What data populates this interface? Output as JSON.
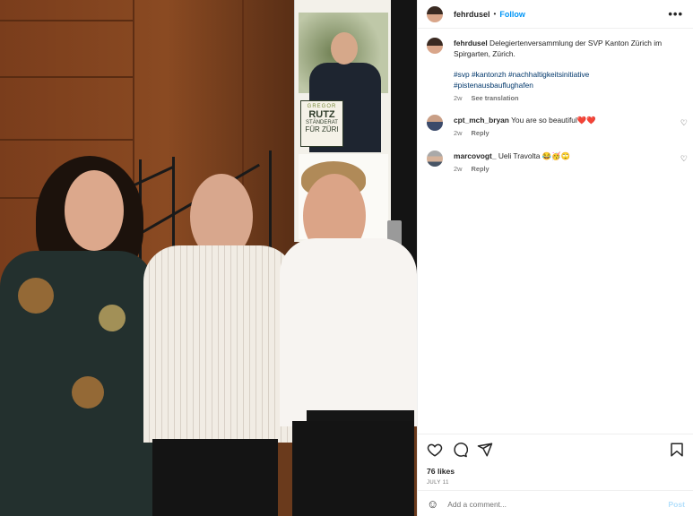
{
  "post": {
    "username": "fehrdusel",
    "follow_label": "Follow",
    "separator": "•",
    "more_label": "•••",
    "caption": "Delegiertenversammlung der SVP Kanton Zürich im Spirgarten, Zürich.",
    "hashtags_line1": "#svp #kantonzh #nachhaltigkeitsinitiative",
    "hashtags_line2": "#pistenausbauflughafen",
    "age": "2w",
    "see_translation": "See translation"
  },
  "banner": {
    "line1": "GREGOR",
    "line2": "RUTZ",
    "line3": "STÄNDERAT",
    "line4": "FÜR ZÜRI"
  },
  "comments": [
    {
      "username": "cpt_mch_bryan",
      "text": "You are so beautiful❤️❤️",
      "age": "2w",
      "reply": "Reply"
    },
    {
      "username": "marcovogt_",
      "text": "Ueli Travolta 😂🥳🙄",
      "age": "2w",
      "reply": "Reply"
    }
  ],
  "footer": {
    "likes": "76 likes",
    "date": "JULY 11",
    "add_comment_placeholder": "Add a comment...",
    "post_label": "Post"
  },
  "icons": {
    "heart": "heart-icon",
    "comment": "comment-icon",
    "share": "share-icon",
    "bookmark": "bookmark-icon",
    "emoji": "emoji-icon"
  },
  "colors": {
    "link_blue": "#0095f6",
    "hashtag_blue": "#00376b",
    "muted": "#737373",
    "post_disabled": "#b2dffc"
  }
}
